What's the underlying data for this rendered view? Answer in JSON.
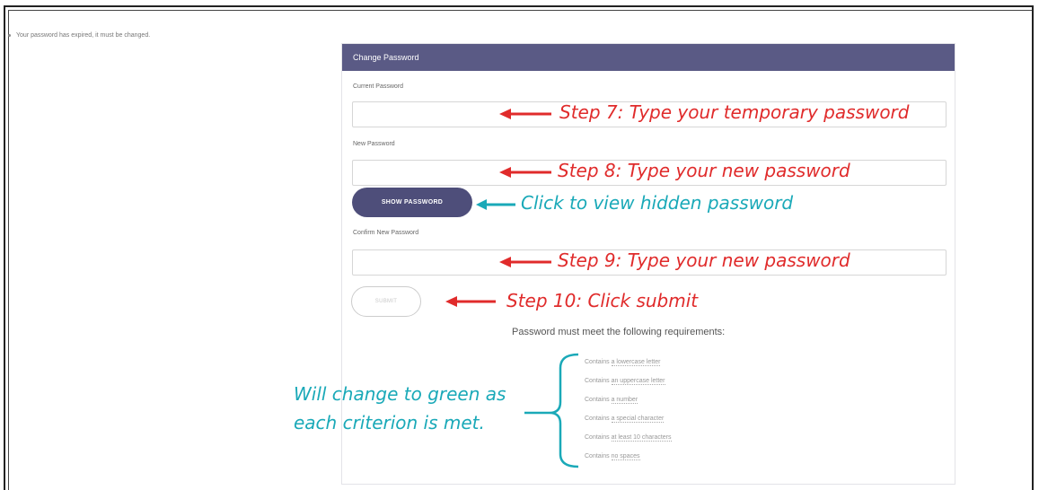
{
  "notice": "Your password has expired, it must be changed.",
  "panel": {
    "title": "Change Password",
    "current_label": "Current Password",
    "new_label": "New Password",
    "confirm_label": "Confirm New Password",
    "show_password": "SHOW PASSWORD",
    "submit": "SUBMIT"
  },
  "requirements": {
    "title": "Password must meet the following requirements:",
    "items": [
      {
        "prefix": "Contains ",
        "highlight": "a lowercase letter"
      },
      {
        "prefix": "Contains ",
        "highlight": "an uppercase letter"
      },
      {
        "prefix": "Contains ",
        "highlight": "a number"
      },
      {
        "prefix": "Contains ",
        "highlight": "a special character"
      },
      {
        "prefix": "Contains ",
        "highlight": "at least 10 characters"
      },
      {
        "prefix": "Contains ",
        "highlight": "no spaces"
      }
    ]
  },
  "annotations": {
    "step7": "Step 7: Type your temporary password",
    "step8": "Step 8: Type your new password",
    "show": "Click to view hidden password",
    "step9": "Step 9: Type your new password",
    "step10": "Step 10: Click submit",
    "green_line1": "Will change to green as",
    "green_line2": "each criterion is met."
  },
  "colors": {
    "header": "#5a5a85",
    "button": "#4e4e7a",
    "annotation_red": "#e02b2b",
    "annotation_teal": "#1aa9b8"
  }
}
